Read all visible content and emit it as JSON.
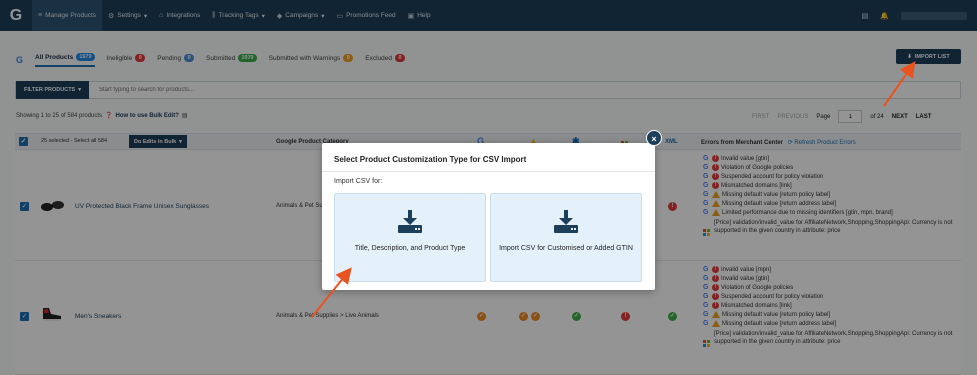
{
  "nav": {
    "logo": "G",
    "items": [
      {
        "label": "Manage Products",
        "icon": "≡",
        "caret": ""
      },
      {
        "label": "Settings",
        "icon": "⚙",
        "caret": "▾"
      },
      {
        "label": "Integrations",
        "icon": "⌂",
        "caret": ""
      },
      {
        "label": "Tracking Tags",
        "icon": "⫼",
        "caret": "▾"
      },
      {
        "label": "Campaigns",
        "icon": "◆",
        "caret": "▾"
      },
      {
        "label": "Promotions Feed",
        "icon": "▭",
        "caret": ""
      },
      {
        "label": "Help",
        "icon": "▣",
        "caret": ""
      }
    ],
    "right_icons": [
      "▤",
      "🔔"
    ]
  },
  "tabs": [
    {
      "label": "All Products",
      "count": "1979",
      "color": "#1e88e5"
    },
    {
      "label": "Ineligible",
      "count": "0",
      "color": "#e23b3b"
    },
    {
      "label": "Pending",
      "count": "0",
      "color": "#4a90d9"
    },
    {
      "label": "Submitted",
      "count": "1979",
      "color": "#3fae49"
    },
    {
      "label": "Submitted with Warnings",
      "count": "0",
      "color": "#f0a020"
    },
    {
      "label": "Excluded",
      "count": "0",
      "color": "#e23b3b"
    }
  ],
  "import_button": "IMPORT LIST",
  "filter": {
    "button": "FILTER PRODUCTS",
    "placeholder": "Start typing to search for products..."
  },
  "showing": {
    "text": "Showing 1 to 25 of 584 products",
    "help": "How to use Bulk Edit?"
  },
  "pager": {
    "first": "FIRST",
    "previous": "PREVIOUS",
    "page_label": "Page",
    "page_value": "1",
    "of": "of 24",
    "next": "NEXT",
    "last": "LAST"
  },
  "table_header": {
    "selected": "25 selected - Select all 584",
    "bulk": "Do Edits in Bulk",
    "category": "Google Product Category",
    "xml": "XML",
    "errors": "Errors from Merchant Center",
    "refresh": "Refresh Product Errors"
  },
  "rows": [
    {
      "name": "UV Protected Black Frame Unisex Sunglasses",
      "category": "Animals & Pet Supplies > Live Animals",
      "errors": [
        {
          "type": "error",
          "text": "Invalid value [gtin]"
        },
        {
          "type": "error",
          "text": "Violation of Google policies"
        },
        {
          "type": "error",
          "text": "Suspended account for policy violation"
        },
        {
          "type": "error",
          "text": "Mismatched domains [link]"
        },
        {
          "type": "warn",
          "text": "Missing default value [return policy label]"
        },
        {
          "type": "warn",
          "text": "Missing default value [return address label]"
        },
        {
          "type": "warn",
          "text": "Limited performance due to missing identifiers [gtin, mpn, brand]"
        }
      ],
      "ms_error": "[Price] validation/invalid_value for AffiliateNetwork,Shopping,ShoppingApi: Currency is not supported in the given country in attribute: price"
    },
    {
      "name": "Men's Sneakers",
      "category": "Animals & Pet Supplies > Live Animals",
      "errors": [
        {
          "type": "error",
          "text": "Invalid value [mpn]"
        },
        {
          "type": "error",
          "text": "Invalid value [gtin]"
        },
        {
          "type": "error",
          "text": "Violation of Google policies"
        },
        {
          "type": "error",
          "text": "Suspended account for policy violation"
        },
        {
          "type": "error",
          "text": "Mismatched domains [link]"
        },
        {
          "type": "warn",
          "text": "Missing default value [return policy label]"
        },
        {
          "type": "warn",
          "text": "Missing default value [return address label]"
        }
      ],
      "ms_error": "[Price] validation/invalid_value for AffiliateNetwork,Shopping,ShoppingApi: Currency is not supported in the given country in attribute: price"
    }
  ],
  "modal": {
    "title": "Select Product Customization Type for CSV Import",
    "subtitle": "Import CSV for:",
    "option1": "Title, Description, and Product Type",
    "option2": "Import CSV for Customised or Added GTIN"
  },
  "colors": {
    "navy": "#1e3f5a",
    "accent": "#1e6fb4",
    "arrow": "#e8531f",
    "option_bg": "#e4f1fb"
  }
}
